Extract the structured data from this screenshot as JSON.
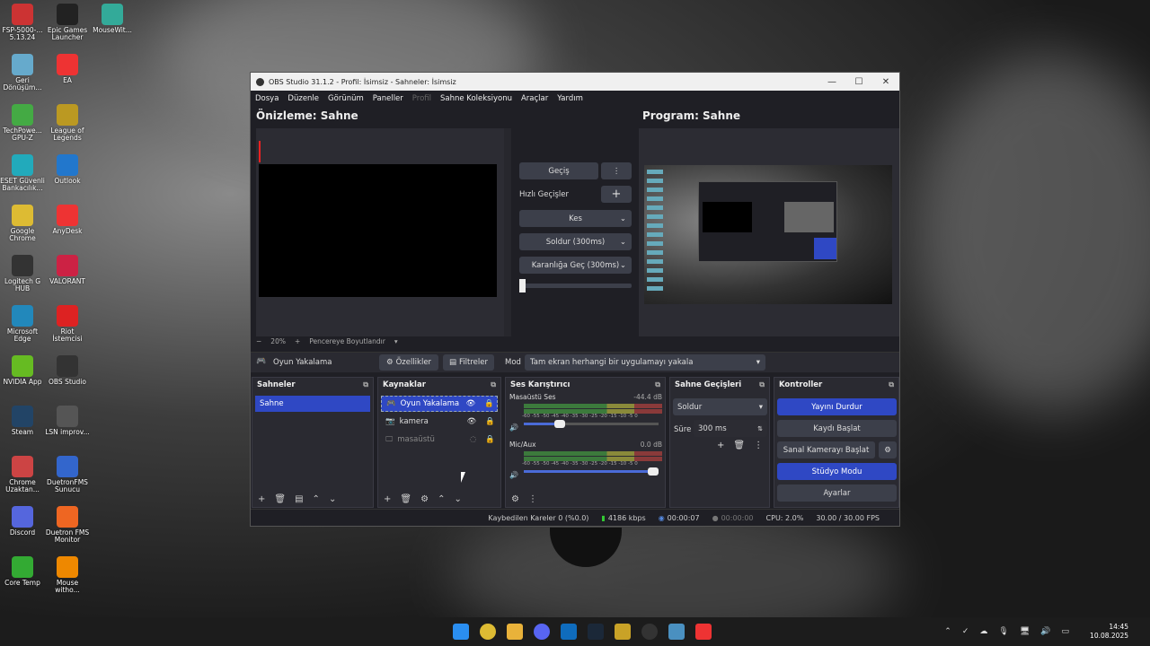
{
  "desktop_icons": [
    {
      "label": "FSP-5000-...\n5.13.24",
      "color": "#c33"
    },
    {
      "label": "Epic Games Launcher",
      "color": "#222"
    },
    {
      "label": "MouseWit...",
      "color": "#3a9"
    },
    {
      "label": "Geri Dönüşüm...",
      "color": "#6ac"
    },
    {
      "label": "EA",
      "color": "#e33"
    },
    {
      "label": "TechPowe...\nGPU-Z",
      "color": "#4a4"
    },
    {
      "label": "League of Legends",
      "color": "#b92"
    },
    {
      "label": "ESET Güvenli Bankacılık...",
      "color": "#2ab"
    },
    {
      "label": "Outlook",
      "color": "#27c"
    },
    {
      "label": "Google Chrome",
      "color": "#db3"
    },
    {
      "label": "AnyDesk",
      "color": "#e33"
    },
    {
      "label": "Logitech G HUB",
      "color": "#333"
    },
    {
      "label": "VALORANT",
      "color": "#c24"
    },
    {
      "label": "Microsoft Edge",
      "color": "#28b"
    },
    {
      "label": "Riot İstemcisi",
      "color": "#d22"
    },
    {
      "label": "NVIDIA App",
      "color": "#6b2"
    },
    {
      "label": "OBS Studio",
      "color": "#333"
    },
    {
      "label": "Steam",
      "color": "#246"
    },
    {
      "label": "LSN improv...",
      "color": "#555"
    },
    {
      "label": "Chrome Uzaktan...",
      "color": "#c44"
    },
    {
      "label": "DuetronFMS Sunucu",
      "color": "#36c"
    },
    {
      "label": "Discord",
      "color": "#56d"
    },
    {
      "label": "Duetron FMS Monitor",
      "color": "#e62"
    },
    {
      "label": "Core Temp",
      "color": "#3a3"
    },
    {
      "label": "Mouse witho...",
      "color": "#e80"
    }
  ],
  "window": {
    "title": "OBS Studio 31.1.2 - Profil: İsimsiz - Sahneler: İsimsiz",
    "min": "—",
    "max": "☐",
    "close": "✕"
  },
  "menu": [
    "Dosya",
    "Düzenle",
    "Görünüm",
    "Paneller",
    "Profil",
    "Sahne Koleksiyonu",
    "Araçlar",
    "Yardım"
  ],
  "preview_title": "Önizleme: Sahne",
  "program_title": "Program: Sahne",
  "transition": {
    "gecis": "Geçiş",
    "hizli": "Hızlı Geçişler",
    "kes": "Kes",
    "soldur": "Soldur (300ms)",
    "karanlik": "Karanlığa Geç (300ms)"
  },
  "zoom": {
    "minus": "−",
    "value": "20%",
    "plus": "+",
    "fit": "Pencereye Boyutlandır"
  },
  "source_bar": {
    "name": "Oyun Yakalama",
    "props": "Özellikler",
    "filters": "Filtreler",
    "mode_label": "Mod",
    "mode_value": "Tam ekran herhangi bir uygulamayı yakala"
  },
  "scenes": {
    "title": "Sahneler",
    "items": [
      "Sahne"
    ]
  },
  "sources": {
    "title": "Kaynaklar",
    "items": [
      "Oyun Yakalama",
      "kamera",
      "masaüstü"
    ]
  },
  "mixer": {
    "title": "Ses Karıştırıcı",
    "ch1": "Masaüstü Ses",
    "ch1_db": "-44.4 dB",
    "ch2": "Mic/Aux",
    "ch2_db": "0.0 dB",
    "scale": "-60 -55 -50 -45 -40 -35 -30 -25 -20 -15 -10 -5 0"
  },
  "transitions_dock": {
    "title": "Sahne Geçişleri",
    "value": "Soldur",
    "dur_label": "Süre",
    "dur_value": "300 ms"
  },
  "controls": {
    "title": "Kontroller",
    "stream": "Yayını Durdur",
    "record": "Kaydı Başlat",
    "vcam": "Sanal Kamerayı Başlat",
    "studio": "Stüdyo Modu",
    "settings": "Ayarlar"
  },
  "status": {
    "dropped": "Kaybedilen Kareler 0 (%0.0)",
    "kbps": "4186 kbps",
    "live": "00:00:07",
    "rec": "00:00:00",
    "cpu": "CPU: 2.0%",
    "fps": "30.00 / 30.00 FPS"
  },
  "clock": {
    "time": "14:45",
    "date": "10.08.2025"
  }
}
